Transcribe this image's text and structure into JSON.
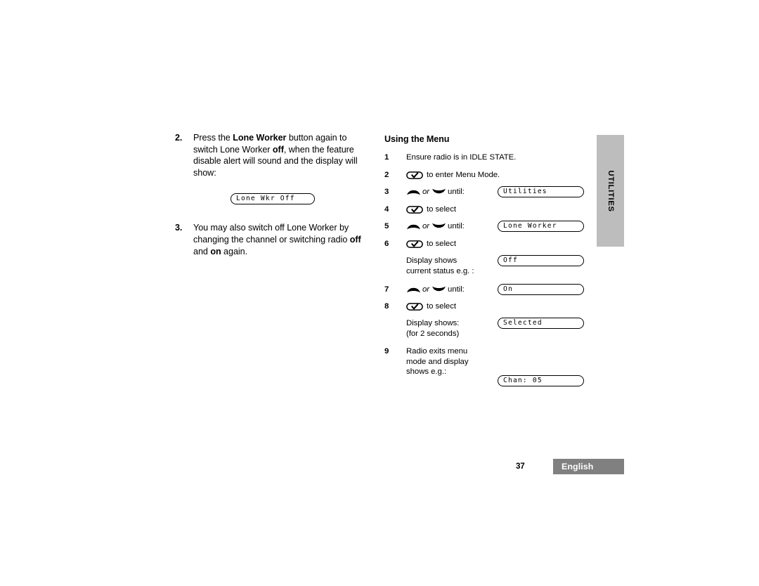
{
  "left_column": {
    "steps": [
      {
        "number": "2.",
        "text_parts": [
          {
            "t": "Press the ",
            "b": false
          },
          {
            "t": "Lone Worker",
            "b": true
          },
          {
            "t": " button again to switch Lone Worker ",
            "b": false
          },
          {
            "t": "off",
            "b": true
          },
          {
            "t": ", when the feature disable alert  will sound and the display will show:",
            "b": false
          }
        ],
        "plain": "Press the Lone Worker button again to switch Lone Worker off, when the feature disable alert  will sound and the display will show:"
      },
      {
        "number": "3.",
        "text_parts": [
          {
            "t": "You may also switch off Lone Worker by changing the channel or switching radio ",
            "b": false
          },
          {
            "t": "off",
            "b": true
          },
          {
            "t": " and ",
            "b": false
          },
          {
            "t": "on",
            "b": true
          },
          {
            "t": " again.",
            "b": false
          }
        ],
        "plain": "You may also switch off Lone Worker by changing the channel or switching radio off and on again."
      }
    ],
    "display_lone_wkr_off": "Lone Wkr Off"
  },
  "right_column": {
    "title": "Using the Menu",
    "or_label": "or",
    "rows": [
      {
        "number": "1",
        "icon": "none",
        "text": "Ensure radio is in IDLE STATE.",
        "lcd": null
      },
      {
        "number": "2",
        "icon": "menu-key",
        "text": "to enter Menu Mode.",
        "lcd": null
      },
      {
        "number": "3",
        "icon": "up-down",
        "text": "until:",
        "lcd": "Utilities"
      },
      {
        "number": "4",
        "icon": "menu-key",
        "text": "to select",
        "lcd": null
      },
      {
        "number": "5",
        "icon": "up-down",
        "text": "until:",
        "lcd": "Lone Worker"
      },
      {
        "number": "6",
        "icon": "menu-key",
        "text": "to select",
        "lcd": null
      },
      {
        "number": "",
        "icon": "none",
        "text": "Display shows current status e.g. :",
        "line1": "Display shows",
        "line2": "current status e.g. :",
        "lcd": "Off"
      },
      {
        "number": "7",
        "icon": "up-down",
        "text": "until:",
        "lcd": "On"
      },
      {
        "number": "8",
        "icon": "menu-key",
        "text": "to select",
        "lcd": null
      },
      {
        "number": "",
        "icon": "none",
        "text": "Display shows: (for 2 seconds)",
        "line1": "Display shows:",
        "line2": "(for 2 seconds)",
        "lcd": "Selected"
      },
      {
        "number": "9",
        "icon": "none",
        "text": "Radio exits menu mode and display shows e.g.:",
        "line1": "Radio exits menu",
        "line2": "mode and display",
        "line3": "shows e.g.:",
        "lcd": "Chan: 05"
      }
    ]
  },
  "side_tab": {
    "label": "UTILITIES",
    "background_color": "#bdbdbd"
  },
  "footer": {
    "page_number": "37",
    "language": "English",
    "badge_color": "#808080",
    "badge_text_color": "#ffffff"
  }
}
